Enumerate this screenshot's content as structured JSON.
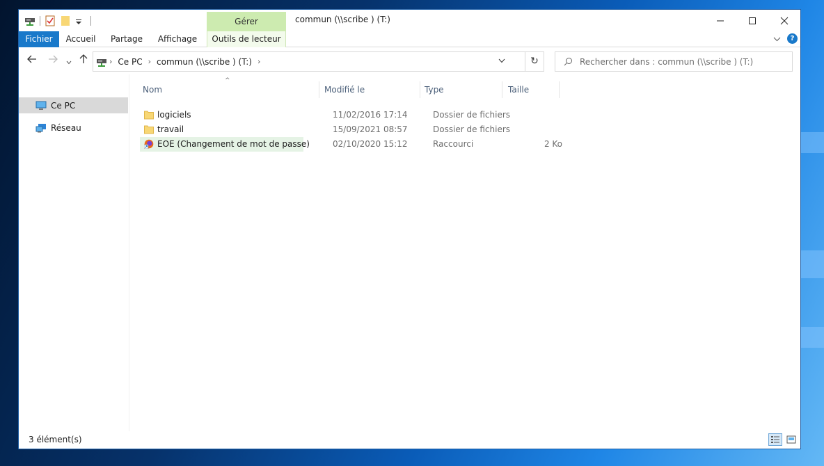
{
  "window": {
    "title": "commun (\\\\scribe ) (T:)",
    "manage_tab": "Gérer",
    "controls": {
      "minimize": "—",
      "maximize": "☐",
      "close": "✕"
    }
  },
  "ribbon": {
    "tabs": [
      "Fichier",
      "Accueil",
      "Partage",
      "Affichage",
      "Outils de lecteur"
    ],
    "help": "?",
    "expand": "⌄"
  },
  "navigation": {
    "back": "←",
    "forward": "→",
    "recent": "⌄",
    "up": "↑",
    "breadcrumbs": [
      "Ce PC",
      "commun (\\\\scribe ) (T:)"
    ],
    "separator": "›",
    "dropdown": "⌄",
    "refresh": "↻",
    "search_placeholder": "Rechercher dans : commun (\\\\scribe ) (T:)"
  },
  "nav_pane": {
    "items": [
      {
        "label": "Ce PC",
        "icon": "computer-icon",
        "selected": true
      },
      {
        "label": "Réseau",
        "icon": "network-icon",
        "selected": false
      }
    ]
  },
  "columns": {
    "name": "Nom",
    "modified": "Modifié le",
    "type": "Type",
    "size": "Taille",
    "sort_indicator": "^"
  },
  "files": [
    {
      "name": "logiciels",
      "modified": "11/02/2016 17:14",
      "type": "Dossier de fichiers",
      "size": "",
      "icon": "folder-icon"
    },
    {
      "name": "travail",
      "modified": "15/09/2021 08:57",
      "type": "Dossier de fichiers",
      "size": "",
      "icon": "folder-icon"
    },
    {
      "name": "EOE (Changement de mot de passe)",
      "modified": "02/10/2020 15:12",
      "type": "Raccourci",
      "size": "2 Ko",
      "icon": "browser-shortcut-icon"
    }
  ],
  "status": {
    "item_count": "3 élément(s)"
  },
  "colors": {
    "accent": "#1979ca",
    "manage_tab_bg": "#cdebb0",
    "selected_row_bg": "#e5f3e5",
    "selected_nav_bg": "#d9d9d9"
  }
}
